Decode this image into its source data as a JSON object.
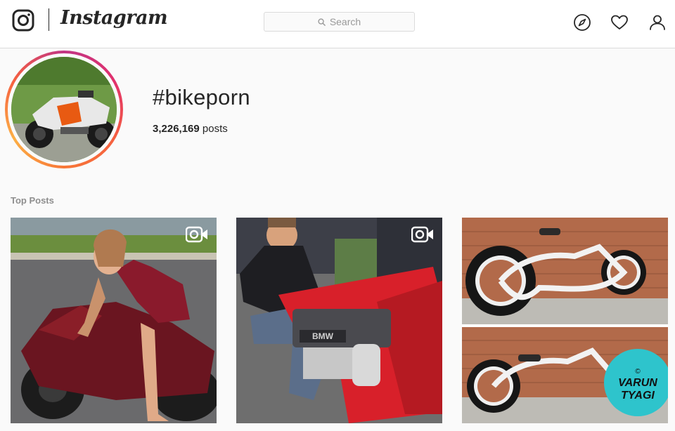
{
  "header": {
    "wordmark": "Instagram",
    "search_placeholder": "Search",
    "icons": [
      "instagram-glyph-icon",
      "search-icon",
      "compass-icon",
      "heart-icon",
      "user-icon"
    ]
  },
  "hashtag": {
    "title": "#bikeporn",
    "post_count": "3,226,169",
    "post_count_unit": " posts"
  },
  "sections": {
    "top_posts_label": "Top Posts"
  },
  "posts": [
    {
      "type": "video",
      "icon": "video-icon"
    },
    {
      "type": "video",
      "icon": "video-icon",
      "engine_text": "BMW"
    },
    {
      "type": "image",
      "watermark_line1": "VARUN",
      "watermark_line2": "TYAGI",
      "watermark_copyright": "©"
    }
  ],
  "colors": {
    "text": "#262626",
    "muted": "#8e8e8e",
    "border": "#dbdbdb",
    "background": "#fafafa",
    "story_ring_start": "#c13584",
    "story_ring_end": "#fcaf45"
  }
}
